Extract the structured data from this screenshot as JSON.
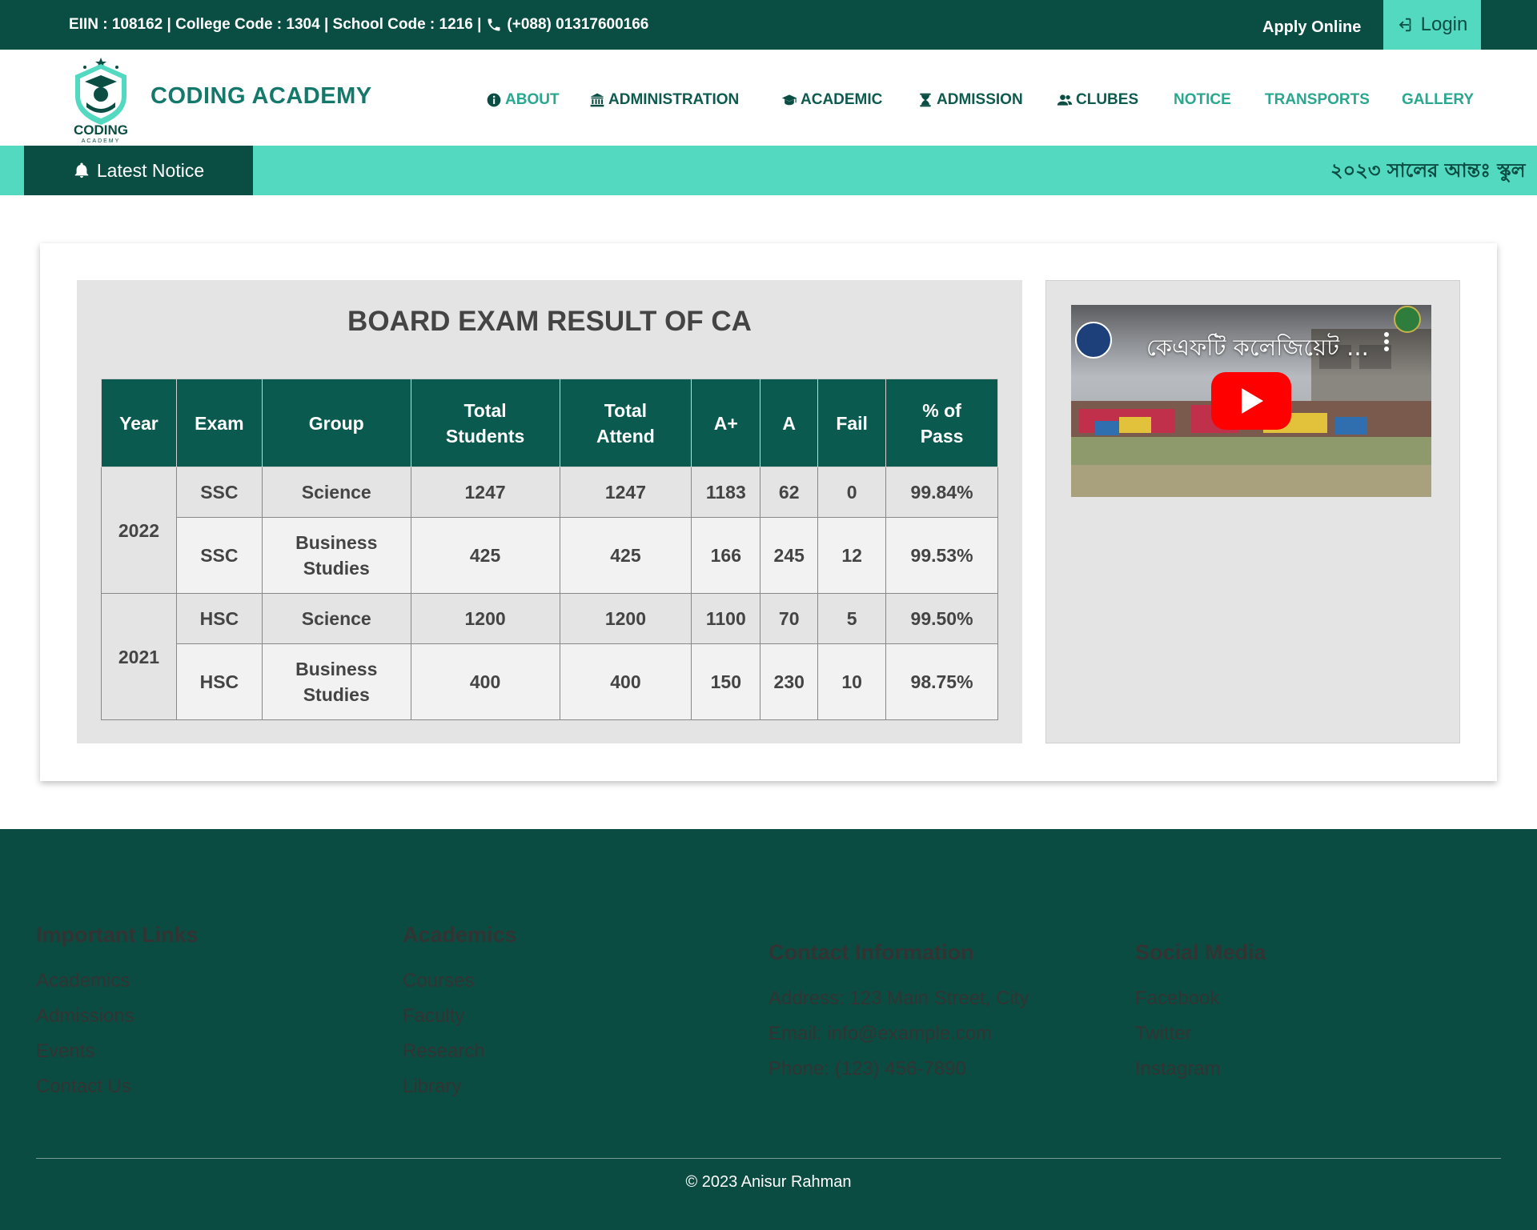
{
  "topbar": {
    "info": "EIIN : 108162 | College Code : 1304 | School Code : 1216 |",
    "phone": "(+088) 01317600166",
    "apply": "Apply Online",
    "login": "Login"
  },
  "brand": {
    "logo_text": "CODING",
    "logo_sub": "ACADEMY",
    "name": "CODING ACADEMY"
  },
  "nav": {
    "about": "ABOUT",
    "administration": "ADMINISTRATION",
    "academic": "ACADEMIC",
    "admission": "ADMISSION",
    "clubes": "CLUBES",
    "notice": "NOTICE",
    "transports": "TRANSPORTS",
    "gallery": "GALLERY"
  },
  "notice": {
    "label": "Latest Notice",
    "text": "২০২৩ সালের আন্তঃ স্কুল"
  },
  "result": {
    "title": "BOARD EXAM RESULT OF CA",
    "headers": [
      "Year",
      "Exam",
      "Group",
      "Total Students",
      "Total Attend",
      "A+",
      "A",
      "Fail",
      "% of Pass"
    ],
    "years": [
      "2022",
      "2021"
    ],
    "rows": [
      {
        "exam": "SSC",
        "group": "Science",
        "total": "1247",
        "attend": "1247",
        "aplus": "1183",
        "a": "62",
        "fail": "0",
        "pass": "99.84%"
      },
      {
        "exam": "SSC",
        "group": "Business Studies",
        "total": "425",
        "attend": "425",
        "aplus": "166",
        "a": "245",
        "fail": "12",
        "pass": "99.53%"
      },
      {
        "exam": "HSC",
        "group": "Science",
        "total": "1200",
        "attend": "1200",
        "aplus": "1100",
        "a": "70",
        "fail": "5",
        "pass": "99.50%"
      },
      {
        "exam": "HSC",
        "group": "Business Studies",
        "total": "400",
        "attend": "400",
        "aplus": "150",
        "a": "230",
        "fail": "10",
        "pass": "98.75%"
      }
    ]
  },
  "video": {
    "title": "কেএফটি কলেজিয়েট ..."
  },
  "footer": {
    "important": {
      "title": "Important Links",
      "items": [
        "Academics",
        "Admissions",
        "Events",
        "Contact Us"
      ]
    },
    "academics": {
      "title": "Academics",
      "items": [
        "Courses",
        "Faculty",
        "Research",
        "Library"
      ]
    },
    "contact": {
      "title": "Contact Information",
      "items": [
        "Address: 123 Main Street, City",
        "Email: info@example.com",
        "Phone: (123) 456-7890"
      ]
    },
    "social": {
      "title": "Social Media",
      "items": [
        "Facebook",
        "Twitter",
        "Instagram"
      ]
    },
    "copyright": "© 2023 Anisur Rahman"
  },
  "colors": {
    "primary": "#0a4d43",
    "accent": "#54d9c1",
    "nav_light": "#29a78f"
  }
}
